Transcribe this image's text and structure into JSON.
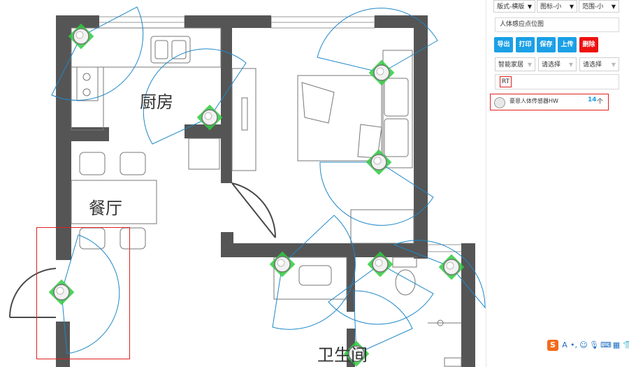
{
  "floorplan": {
    "rooms": {
      "kitchen": "厨房",
      "dining": "餐厅",
      "bathroom": "卫生间"
    },
    "colors": {
      "wall": "#555555",
      "door_arc": "#4a4a4a",
      "coverage": "#1e88c8",
      "sensor_marker": "#2ecc40",
      "selection": "#e02020"
    }
  },
  "panel": {
    "layout_select": "版式-横版",
    "icon_select": "图标-小",
    "range_select": "范围-小",
    "title_input": "人体感应点位图",
    "buttons": {
      "export": "导出",
      "print": "打印",
      "save": "保存",
      "upload": "上传",
      "delete": "删除"
    },
    "button_colors": {
      "primary": "#1aa0e6",
      "danger": "#ee1111"
    },
    "category_select": "智能家居",
    "sub_select_1": "请选择",
    "sub_select_2": "请选择",
    "filter_input": "RT",
    "sensor": {
      "name": "豪恩人体传感器HW",
      "count": "14",
      "unit": "个"
    }
  },
  "tray": {
    "icons": [
      "sogou-ime-icon",
      "chinese-mode-icon",
      "punctuation-icon",
      "emoji-icon",
      "microphone-icon",
      "keyboard-icon",
      "toolbox-icon",
      "skin-icon"
    ],
    "ime_label": "S",
    "lang_label": "A"
  }
}
